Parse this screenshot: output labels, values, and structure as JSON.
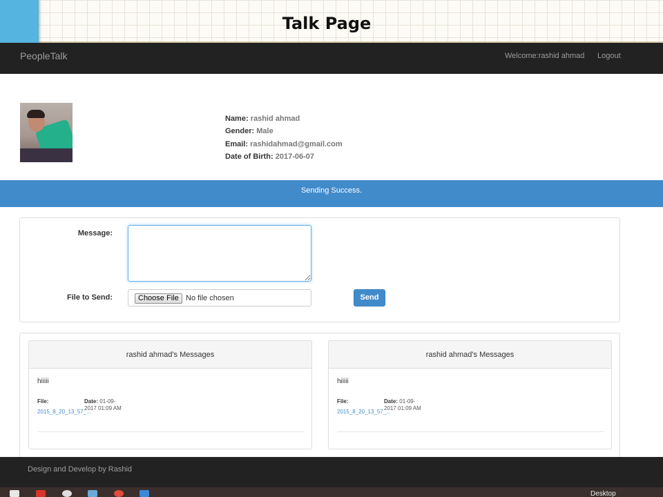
{
  "slide": {
    "title": "Talk Page"
  },
  "navbar": {
    "brand": "PeopleTalk",
    "welcome": "Welcome:rashid ahmad",
    "logout": "Logout"
  },
  "profile": {
    "name_label": "Name:",
    "name": "rashid ahmad",
    "gender_label": "Gender:",
    "gender": "Male",
    "email_label": "Email:",
    "email": "rashidahmad@gmail.com",
    "dob_label": "Date of Birth:",
    "dob": "2017-06-07"
  },
  "alert": {
    "text": "Sending Success."
  },
  "form": {
    "message_label": "Message:",
    "message_value": "",
    "file_label": "File to Send:",
    "choose_file": "Choose File",
    "no_file": "No file chosen",
    "send": "Send"
  },
  "messages": [
    {
      "header": "rashid ahmad's Messages",
      "text": "hiiiii",
      "file_label": "File:",
      "file_link": "2015_8_20_13_57_...",
      "date_label": "Date:",
      "date_value": "01-09-2017 01:09 AM"
    },
    {
      "header": "rashid ahmad's Messages",
      "text": "hiiiii",
      "file_label": "File:",
      "file_link": "2015_8_20_13_57_...",
      "date_label": "Date:",
      "date_value": "01-09-2017 01:09 AM"
    }
  ],
  "footer": {
    "text": "Design and Develop by Rashid"
  },
  "taskbar": {
    "desktop_label": "Desktop",
    "icons": [
      "windows-icon",
      "pdf-icon",
      "chrome-icon",
      "box-icon",
      "chrome-icon",
      "app-icon"
    ]
  },
  "colors": {
    "navbar": "#222222",
    "alert": "#428bca",
    "slide_accent": "#56b4e0",
    "primary_button": "#428bca"
  }
}
